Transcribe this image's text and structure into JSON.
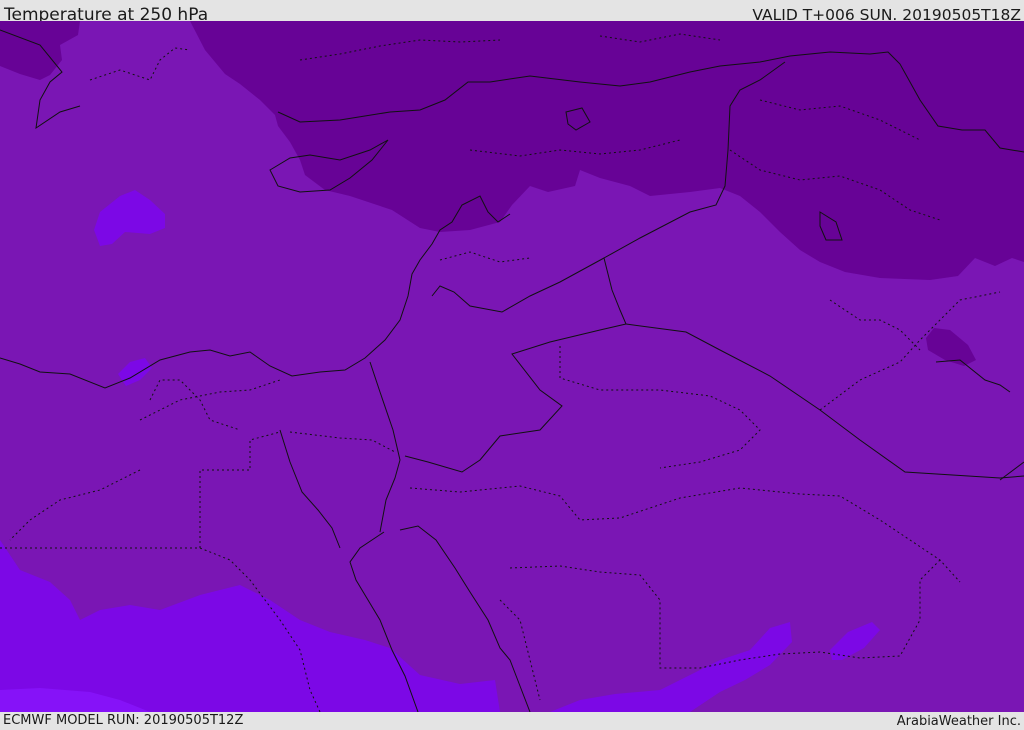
{
  "header": {
    "title": "Temperature at 250 hPa",
    "valid_time": "VALID T+006 SUN. 20190505T18Z"
  },
  "footer": {
    "model_run": "ECMWF MODEL RUN: 20190505T12Z",
    "credit": "ArabiaWeather Inc."
  },
  "map": {
    "colors": {
      "background_band": "#7a16b4",
      "cold_band": "#670396",
      "warm_band": "#7c08e6",
      "warmest_band": "#8612f8",
      "border_line": "#111111",
      "background": "#e4e4e4"
    }
  }
}
